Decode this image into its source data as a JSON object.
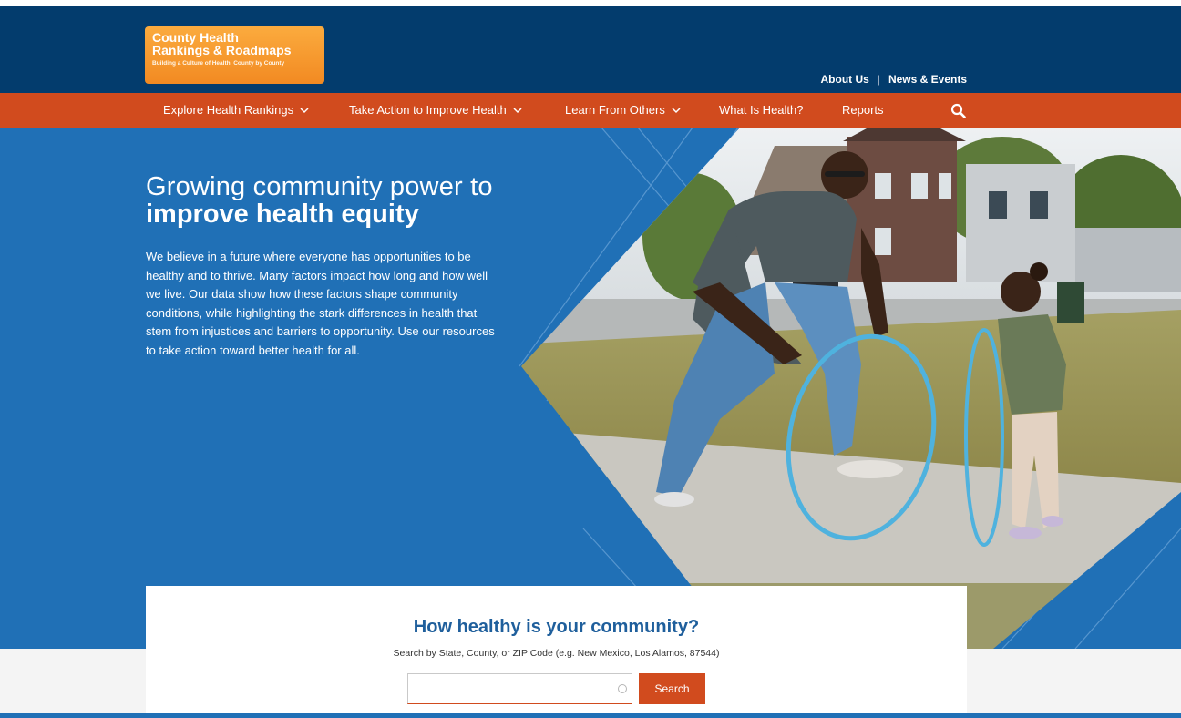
{
  "logo": {
    "line1": "County Health",
    "line2": "Rankings & Roadmaps",
    "tagline": "Building a Culture of Health, County by County"
  },
  "utility_nav": {
    "about": "About Us",
    "separator": "|",
    "news": "News & Events"
  },
  "main_nav": {
    "items": [
      {
        "label": "Explore Health Rankings",
        "dropdown": true
      },
      {
        "label": "Take Action to Improve Health",
        "dropdown": true
      },
      {
        "label": "Learn From Others",
        "dropdown": true
      },
      {
        "label": "What Is Health?",
        "dropdown": false
      },
      {
        "label": "Reports",
        "dropdown": false
      }
    ],
    "search_icon": "search-icon"
  },
  "hero": {
    "headline_light": "Growing community power to",
    "headline_bold": "improve health equity",
    "body": "We believe in a future where everyone has opportunities to be healthy and to thrive. Many factors impact how long and how well we live. Our data show how these factors shape community conditions, while highlighting the stark differences in health that stem from injustices and barriers to opportunity. Use our resources to take action toward better health for all."
  },
  "search": {
    "question": "How healthy is your community?",
    "hint": "Search by State, County, or ZIP Code (e.g. New Mexico, Los Alamos, 87544)",
    "input_value": "",
    "input_placeholder": "",
    "button_label": "Search"
  },
  "colors": {
    "header_navy": "#033c6d",
    "nav_orange": "#d14b1e",
    "hero_blue": "#2070b6",
    "logo_orange": "#f28a22",
    "heading_blue": "#1f5f9c"
  }
}
